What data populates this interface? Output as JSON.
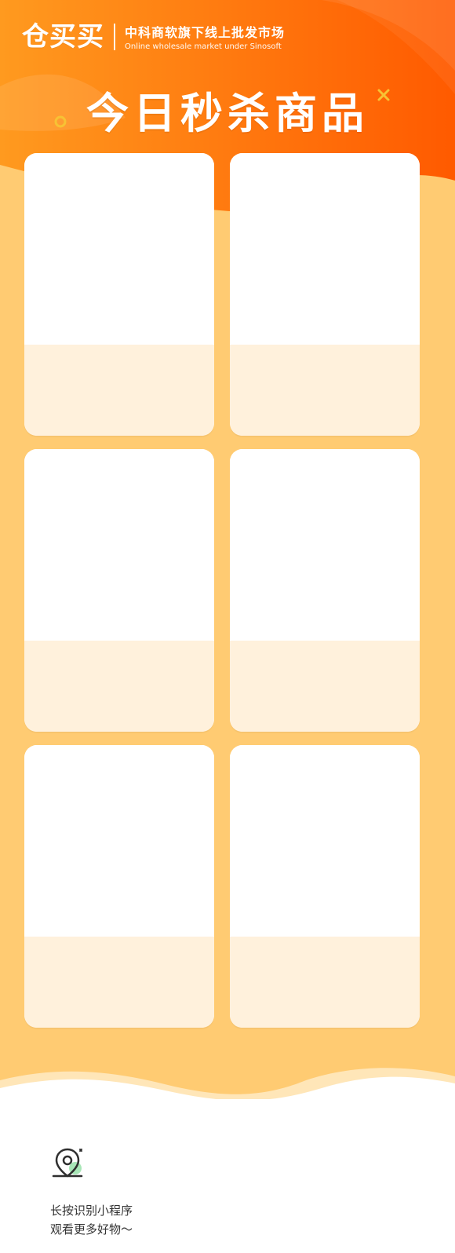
{
  "header": {
    "logo_text": "仓买买",
    "brand_title": "中科商软旗下线上批发市场",
    "brand_subtitle": "Online wholesale market under Sinosoft",
    "headline": "今日秒杀商品"
  },
  "products": [
    {
      "id": 1
    },
    {
      "id": 2
    },
    {
      "id": 3
    },
    {
      "id": 4
    },
    {
      "id": 5
    },
    {
      "id": 6
    }
  ],
  "footer": {
    "icon": "mini-program-location-icon",
    "line1": "长按识别小程序",
    "line2": "观看更多好物～"
  },
  "colors": {
    "header_orange_light": "#FF9A1F",
    "header_orange_dark": "#FF5A00",
    "page_bg": "#FFCB72",
    "card_bottom": "#FFF1DC",
    "accent_yellow": "#F7C234",
    "footer_text": "#333333"
  }
}
